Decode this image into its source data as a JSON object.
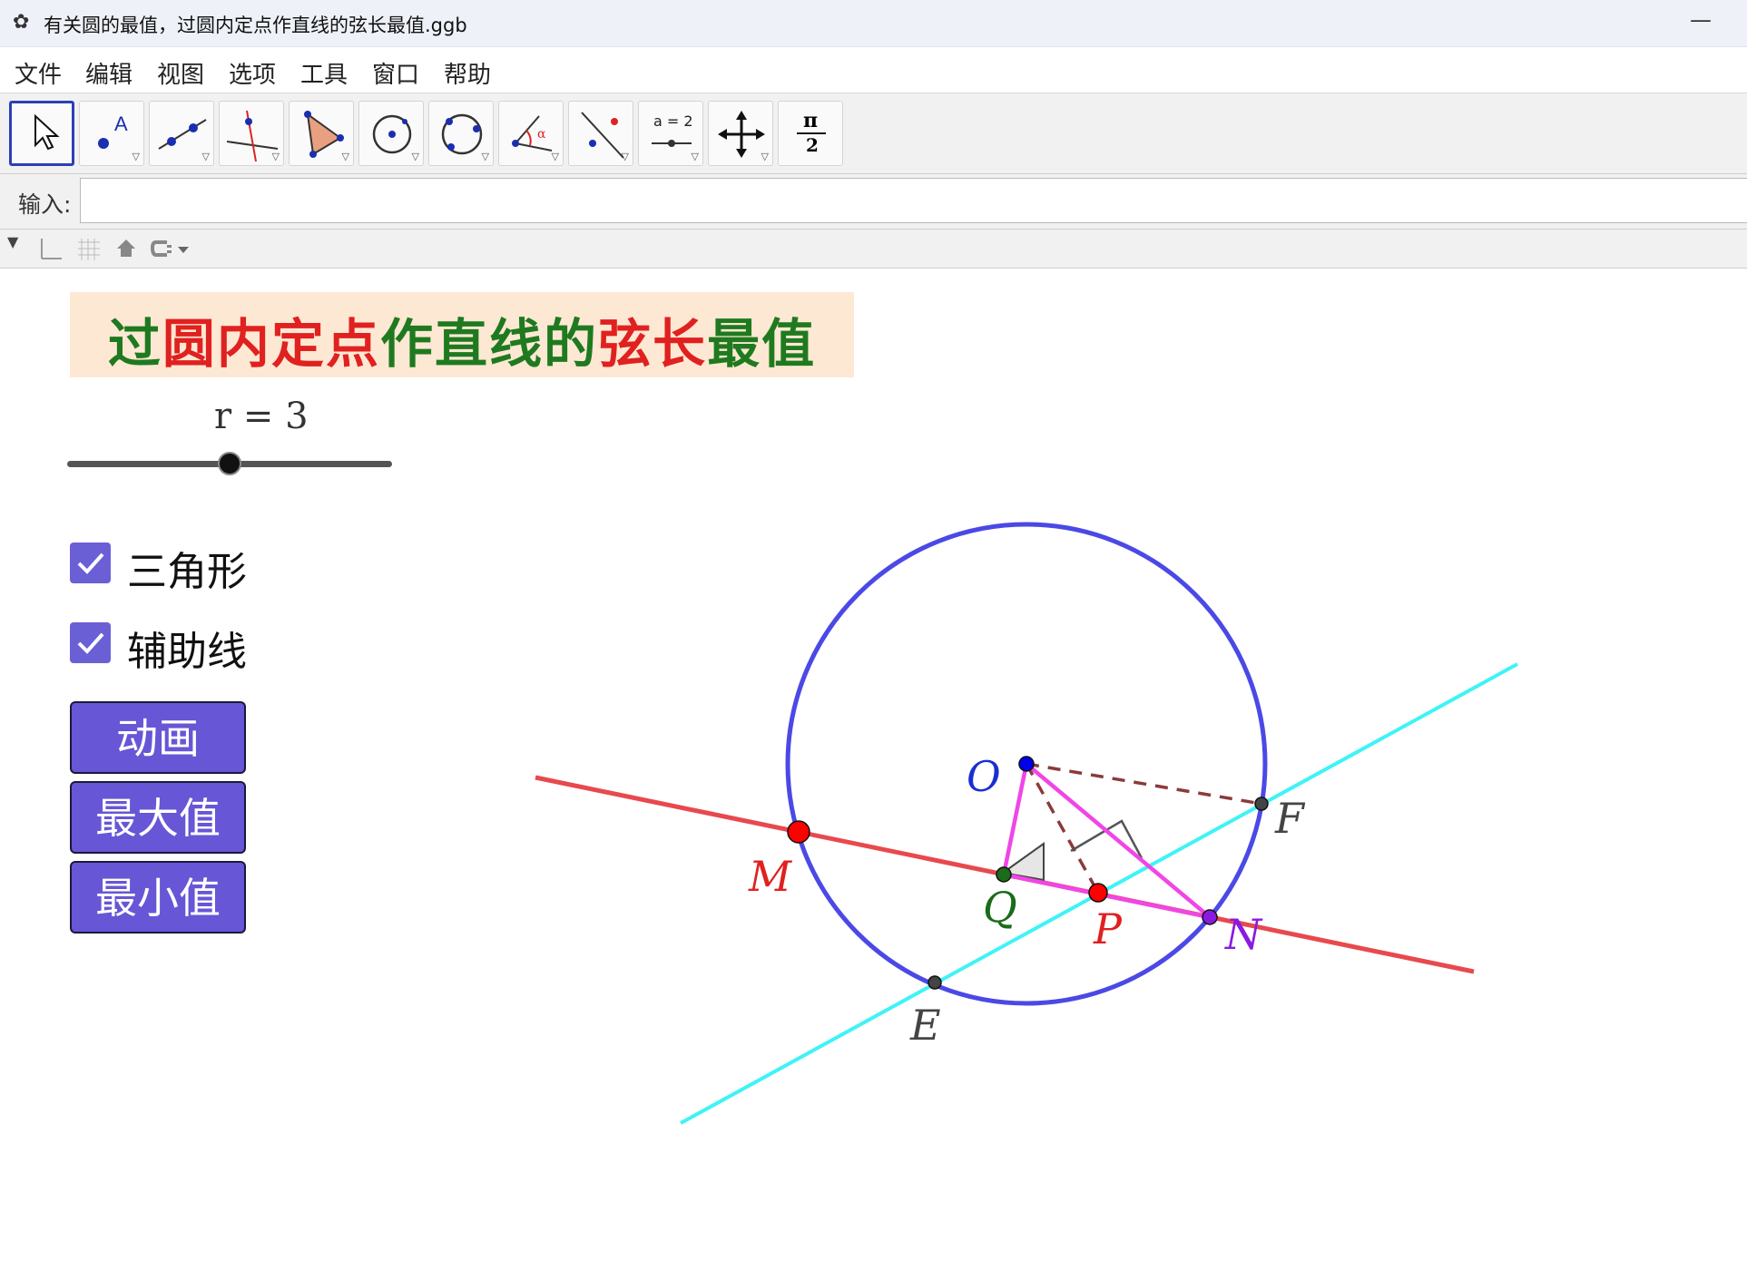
{
  "window": {
    "title": "有关圆的最值，过圆内定点作直线的弦长最值.ggb",
    "minimize": "—"
  },
  "menu": [
    "文件",
    "编辑",
    "视图",
    "选项",
    "工具",
    "窗口",
    "帮助"
  ],
  "toolbar": {
    "tools": [
      "move-tool",
      "point-tool",
      "line-tool",
      "perpendicular-line-tool",
      "polygon-tool",
      "circle-center-point-tool",
      "circle-three-points-tool",
      "angle-tool",
      "reflect-tool",
      "slider-tool",
      "move-view-tool",
      "pi-tool"
    ],
    "slider_tool_text": "a = 2",
    "pi_tool_top": "π",
    "pi_tool_bottom": "2"
  },
  "input": {
    "label": "输入:",
    "value": ""
  },
  "canvas": {
    "heading_parts": [
      {
        "text": "过",
        "color": "#1f7a1f"
      },
      {
        "text": "圆",
        "color": "#e0211f"
      },
      {
        "text": "内",
        "color": "#e0211f"
      },
      {
        "text": "定",
        "color": "#e0211f"
      },
      {
        "text": "点",
        "color": "#e0211f"
      },
      {
        "text": "作",
        "color": "#1f7a1f"
      },
      {
        "text": "直",
        "color": "#1f7a1f"
      },
      {
        "text": "线",
        "color": "#1f7a1f"
      },
      {
        "text": "的",
        "color": "#1f7a1f"
      },
      {
        "text": "弦",
        "color": "#e0211f"
      },
      {
        "text": "长",
        "color": "#e0211f"
      },
      {
        "text": "最",
        "color": "#1f7a1f"
      },
      {
        "text": "值",
        "color": "#1f7a1f"
      }
    ],
    "slider": {
      "label": "r = 3",
      "value": 3,
      "fraction": 0.5
    },
    "checkboxes": [
      {
        "label": "三角形",
        "checked": true
      },
      {
        "label": "辅助线",
        "checked": true
      }
    ],
    "buttons": [
      "动画",
      "最大值",
      "最小值"
    ],
    "points": {
      "O": "O",
      "M": "M",
      "N": "N",
      "P": "P",
      "Q": "Q",
      "E": "E",
      "F": "F"
    },
    "colors": {
      "circle": "#4b49e6",
      "red_line": "#e8494e",
      "cyan_line": "#3ff3f7",
      "triangle": "#f046e6",
      "dashed": "#8b3a3a",
      "button": "#6756d6",
      "checkbox": "#6b5fd6",
      "point_M": "#ff0000",
      "point_P": "#ff0000",
      "point_N": "#8b1ae0",
      "point_O": "#0000ee",
      "point_Q": "#1a6b1a",
      "point_EF": "#444444"
    }
  }
}
